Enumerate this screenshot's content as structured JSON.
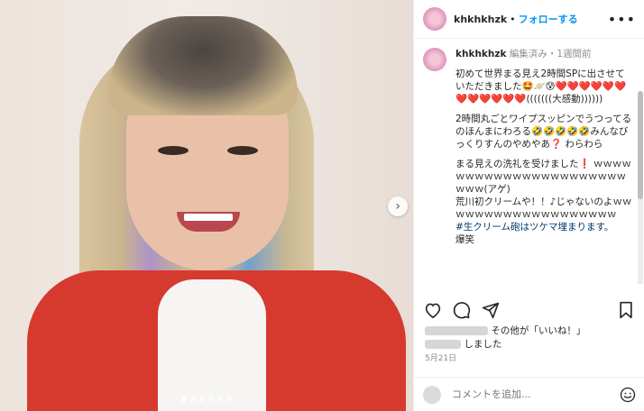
{
  "header": {
    "username": "khkhkhzk",
    "separator": "•",
    "follow_label": "フォローする",
    "more_icon": "more-horizontal-icon"
  },
  "caption": {
    "username": "khkhkhzk",
    "edited": "編集済み",
    "separator": "・",
    "time": "1週間前",
    "paragraphs": [
      "初めて世界まる見え2時間SPに出させていただきました🤩🪐😰❤️❤️❤️❤️❤️❤️❤️❤️❤️❤️❤️❤️(((((((大感動))))))",
      "2時間丸ごとワイプスッピンでうつってるのほんまにわろる🤣🤣🤣🤣🤣みんなびっくりすんのやめやあ❓ わらわら",
      "まる見えの洗礼を受けました❗ ｗｗｗｗｗｗｗｗｗｗｗｗｗｗｗｗｗｗｗｗｗｗｗｗｗ(アゲ)\n荒川初クリームや！！♪じゃないのよｗｗｗｗｗｗｗｗｗｗｗｗｗｗｗｗｗｗｗ"
    ],
    "hashtag": "#生クリーム砲はツケマ埋まります。",
    "tail": "爆笑"
  },
  "likes": {
    "text_pre": "その他が「いいね！」",
    "text_post": "しました"
  },
  "date": "5月21日",
  "comment_box": {
    "placeholder": "コメントを追加..."
  },
  "carousel": {
    "dots": 6,
    "active": 0
  }
}
